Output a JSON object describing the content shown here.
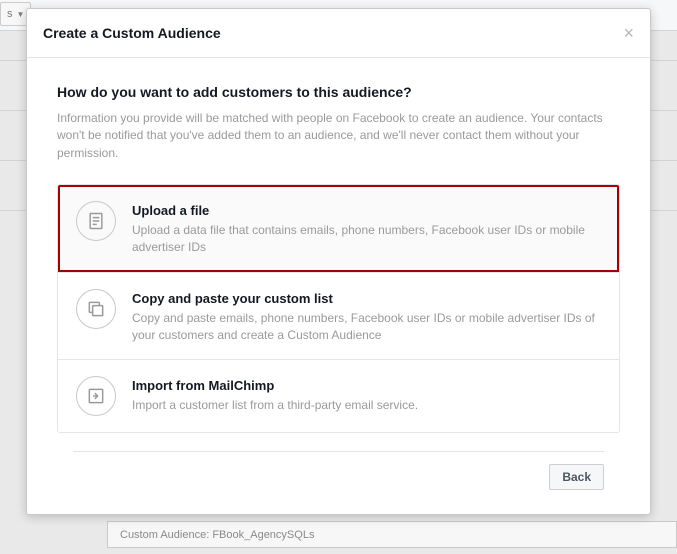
{
  "background": {
    "dropdown_label": "s",
    "sub_label": "Custom Audience: FBook_AgencySQLs"
  },
  "modal": {
    "title": "Create a Custom Audience",
    "heading": "How do you want to add customers to this audience?",
    "description": "Information you provide will be matched with people on Facebook to create an audience. Your contacts won't be notified that you've added them to an audience, and we'll never contact them without your permission.",
    "options": [
      {
        "title": "Upload a file",
        "desc": "Upload a data file that contains emails, phone numbers, Facebook user IDs or mobile advertiser IDs",
        "selected": true,
        "icon": "file"
      },
      {
        "title": "Copy and paste your custom list",
        "desc": "Copy and paste emails, phone numbers, Facebook user IDs or mobile advertiser IDs of your customers and create a Custom Audience",
        "selected": false,
        "icon": "copy"
      },
      {
        "title": "Import from MailChimp",
        "desc": "Import a customer list from a third-party email service.",
        "selected": false,
        "icon": "import"
      }
    ],
    "back_label": "Back"
  }
}
